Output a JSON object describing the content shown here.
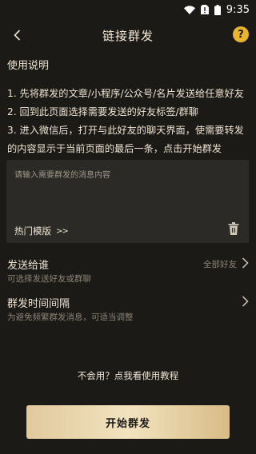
{
  "status_bar": {
    "time": "9:35",
    "battery": "🔋"
  },
  "header": {
    "title": "链接群发",
    "help_label": "?"
  },
  "instructions": {
    "title": "使用说明",
    "lines": [
      "1. 先将群发的文章/小程序/公众号/名片发送给任意好友",
      "2. 回到此页面选择需要发送的好友标签/群聊",
      "3. 进入微信后，打开与此好友的聊天界面，使需要转发",
      "的内容显示于当前页面的最后一条，点击开始群发"
    ]
  },
  "message_box": {
    "placeholder": "请输入需要群发的消息内容",
    "value": "",
    "template_label": "热门模版",
    "template_arrow": ">>"
  },
  "send_to": {
    "label": "发送给谁",
    "hint": "可选择发送好友或群聊",
    "value": "全部好友"
  },
  "interval": {
    "label": "群发时间间隔",
    "hint": "为避免频繁群发消息，可适当调整"
  },
  "help_link": "不会用？点我看使用教程",
  "start_button": "开始群发",
  "colors": {
    "background": "#1c1a17",
    "accent_yellow": "#e9b52e",
    "button_gold": "#e8d3a8",
    "text_muted": "#8a8376"
  }
}
